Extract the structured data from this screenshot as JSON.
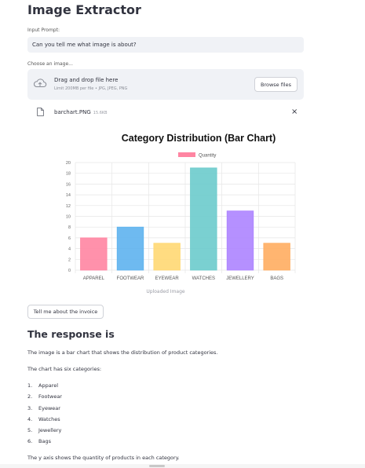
{
  "app": {
    "title": "Image Extractor"
  },
  "prompt": {
    "label": "Input Prompt:",
    "value": "Can you tell me what image is about?"
  },
  "uploader": {
    "label": "Choose an image...",
    "drop_title": "Drag and drop file here",
    "drop_limits": "Limit 200MB per file • JPG, JPEG, PNG",
    "browse_label": "Browse files",
    "icon": "upload-cloud-icon"
  },
  "file": {
    "name": "barchart.PNG",
    "size": "15.6KB",
    "icon": "file-icon",
    "close": "×"
  },
  "image_caption": "Uploaded Image",
  "invoice_button": "Tell me about the invoice",
  "response": {
    "heading": "The response is",
    "intro": "The image is a bar chart that shows the distribution of product categories.",
    "categories_intro": "The chart has six categories:",
    "categories": [
      {
        "num": "1.",
        "name": "Apparel"
      },
      {
        "num": "2.",
        "name": "Footwear"
      },
      {
        "num": "3.",
        "name": "Eyewear"
      },
      {
        "num": "4.",
        "name": "Watches"
      },
      {
        "num": "5.",
        "name": "Jewellery"
      },
      {
        "num": "6.",
        "name": "Bags"
      }
    ],
    "axis_note": "The y axis shows the quantity of products in each category."
  },
  "chart_data": {
    "type": "bar",
    "title": "Category Distribution (Bar Chart)",
    "categories": [
      "APPAREL",
      "FOOTWEAR",
      "EYEWEAR",
      "WATCHES",
      "JEWELLERY",
      "BAGS"
    ],
    "series": [
      {
        "name": "Quantity",
        "values": [
          6,
          8,
          5,
          19,
          11,
          5
        ]
      }
    ],
    "ylim": [
      0,
      20
    ],
    "yticks": [
      0,
      2,
      4,
      6,
      8,
      10,
      12,
      14,
      16,
      18,
      20
    ],
    "grid": true,
    "legend": "top-center",
    "colors": [
      "#ff85a2",
      "#5eb3ee",
      "#ffd873",
      "#6ccbcc",
      "#ad84ff",
      "#ffad61"
    ],
    "legend_color": "#ff85a2"
  }
}
